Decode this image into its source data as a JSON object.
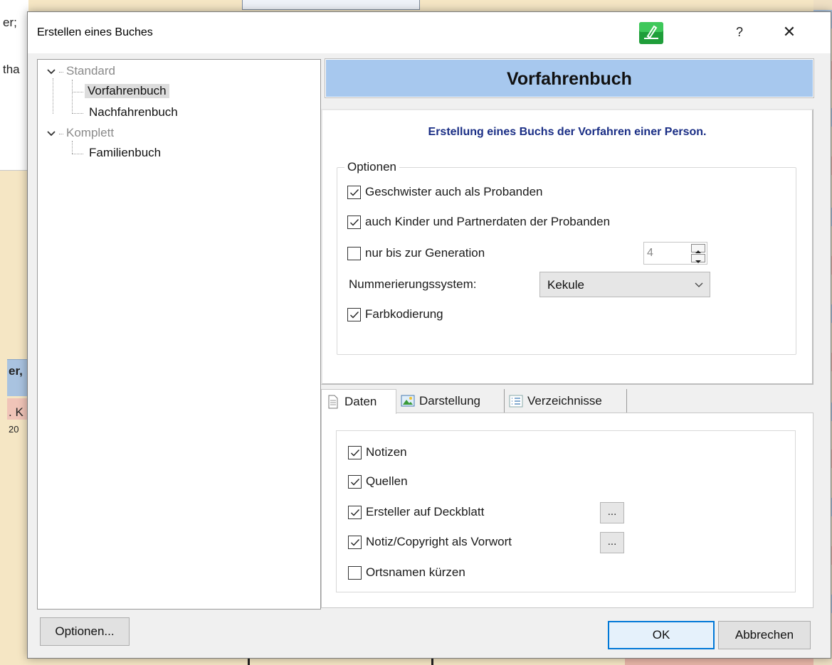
{
  "background": {
    "left_texts": [
      "er;",
      "tha",
      "er,",
      ". K",
      "20"
    ],
    "accent_blue": "#a9c3e0",
    "accent_pink": "#f0c4b8"
  },
  "dialog": {
    "title": "Erstellen eines Buches",
    "help_label": "?",
    "close_label": "✕"
  },
  "tree": {
    "groups": [
      {
        "label": "Standard",
        "children": [
          "Vorfahrenbuch",
          "Nachfahrenbuch"
        ]
      },
      {
        "label": "Komplett",
        "children": [
          "Familienbuch"
        ]
      }
    ],
    "selected": "Vorfahrenbuch"
  },
  "header": {
    "title": "Vorfahrenbuch"
  },
  "options_panel": {
    "description": "Erstellung eines Buchs der Vorfahren einer Person.",
    "group_label": "Optionen",
    "siblings": {
      "label": "Geschwister auch als Probanden",
      "checked": true
    },
    "children_partners": {
      "label": "auch Kinder und Partnerdaten der Probanden",
      "checked": true
    },
    "generation_limit": {
      "label": "nur bis zur Generation",
      "checked": false,
      "value": "4"
    },
    "numbering": {
      "label": "Nummerierungssystem:",
      "selected": "Kekule"
    },
    "color_coding": {
      "label": "Farbkodierung",
      "checked": true
    }
  },
  "tabs": [
    {
      "label": "Daten",
      "icon": "document-icon",
      "active": true
    },
    {
      "label": "Darstellung",
      "icon": "image-icon",
      "active": false
    },
    {
      "label": "Verzeichnisse",
      "icon": "list-icon",
      "active": false
    }
  ],
  "daten_tab": {
    "notes": {
      "label": "Notizen",
      "checked": true
    },
    "sources": {
      "label": "Quellen",
      "checked": true
    },
    "author_cover": {
      "label": "Ersteller auf Deckblatt",
      "checked": true,
      "button": "..."
    },
    "copyright_preface": {
      "label": "Notiz/Copyright als Vorwort",
      "checked": true,
      "button": "..."
    },
    "shorten_places": {
      "label": "Ortsnamen kürzen",
      "checked": false
    }
  },
  "footer": {
    "options_button": "Optionen...",
    "ok_button": "OK",
    "cancel_button": "Abbrechen"
  },
  "colors": {
    "header_bg": "#a7c8ee",
    "description_text": "#1a2e85",
    "default_button_border": "#0078d7"
  }
}
